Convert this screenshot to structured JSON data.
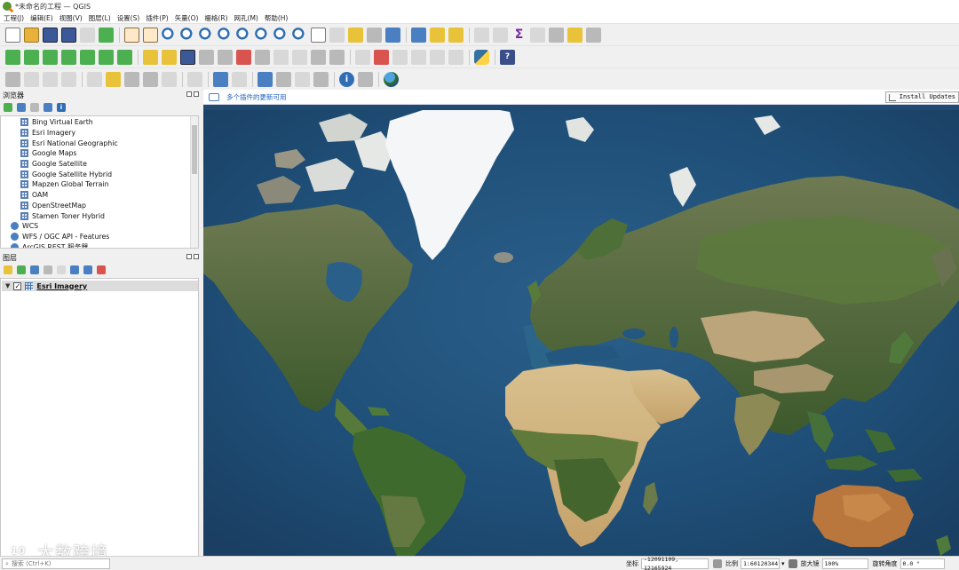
{
  "window": {
    "title": "*未命名的工程 — QGIS"
  },
  "menu": [
    "工程(J)",
    "编辑(E)",
    "视图(V)",
    "图层(L)",
    "设置(S)",
    "插件(P)",
    "矢量(O)",
    "栅格(R)",
    "网孔(M)",
    "帮助(H)"
  ],
  "toolbar": {
    "row1": [
      "new-project-icon",
      "open-project-icon",
      "save-project-icon",
      "save-as-icon",
      "print-layout-icon",
      "style-manager-icon",
      "sep",
      "pan-icon",
      "pan-to-selection-icon",
      "zoom-in-icon",
      "zoom-out-icon",
      "zoom-full-icon",
      "zoom-selection-icon",
      "zoom-layer-icon",
      "zoom-native-icon",
      "zoom-last-icon",
      "zoom-next-icon",
      "new-bookmark-icon",
      "show-bookmarks-icon",
      "map-tips-icon",
      "temporal-icon",
      "refresh-icon",
      "sep",
      "identify-icon",
      "select-icon",
      "deselect-icon",
      "sep",
      "field-calculator-icon",
      "attribute-table-icon",
      "statistics-icon",
      "layout-icon",
      "measure-icon",
      "annotation-icon",
      "settings-icon"
    ],
    "row2": [
      "data-source-icon",
      "add-vector-icon",
      "add-raster-icon",
      "add-mesh-icon",
      "add-text-icon",
      "add-virtual-icon",
      "add-wms-icon",
      "sep",
      "edit-pencil-icon",
      "toggle-edit-icon",
      "save-edits-icon",
      "digitize-icon",
      "node-tool-icon",
      "delete-icon",
      "cut-icon",
      "copy-icon",
      "paste-icon",
      "undo-icon",
      "redo-icon",
      "sep",
      "label-tool-icon",
      "pin-label-icon",
      "show-label-icon",
      "move-label-icon",
      "rotate-label-icon",
      "change-label-icon",
      "sep",
      "python-console-icon",
      "sep",
      "help-icon"
    ],
    "row3": [
      "digitize-shape-icon",
      "offset-curve-icon",
      "reshape-icon",
      "split-icon",
      "sep",
      "text-annotation-icon",
      "select-by-location-icon",
      "vertex-tool-icon",
      "simplify-icon",
      "rotate-icon",
      "sep",
      "table-icon",
      "sep",
      "georef-icon",
      "shape-icon",
      "sep",
      "identify2-icon",
      "dock-icon",
      "shape2-icon",
      "snap-icon",
      "sep",
      "info-icon",
      "measure2-icon",
      "sep",
      "globe-icon"
    ]
  },
  "browser": {
    "title": "浏览器",
    "items": [
      {
        "label": "Bing Virtual Earth",
        "type": "tile"
      },
      {
        "label": "Esri Imagery",
        "type": "tile"
      },
      {
        "label": "Esri National Geographic",
        "type": "tile"
      },
      {
        "label": "Google Maps",
        "type": "tile"
      },
      {
        "label": "Google Satellite",
        "type": "tile"
      },
      {
        "label": "Google Satellite Hybrid",
        "type": "tile"
      },
      {
        "label": "Mapzen Global Terrain",
        "type": "tile"
      },
      {
        "label": "OAM",
        "type": "tile"
      },
      {
        "label": "OpenStreetMap",
        "type": "tile"
      },
      {
        "label": "Stamen Toner Hybrid",
        "type": "tile"
      },
      {
        "label": "WCS",
        "type": "service"
      },
      {
        "label": "WFS / OGC API - Features",
        "type": "service"
      },
      {
        "label": "ArcGIS REST 服务器",
        "type": "service"
      }
    ]
  },
  "layers": {
    "title": "图层",
    "items": [
      {
        "name": "Esri Imagery",
        "checked": true,
        "expanded": true
      }
    ]
  },
  "message_bar": {
    "text": "多个插件的更新可用",
    "button": "Install Updates"
  },
  "map": {
    "layer": "Esri Imagery",
    "ocean_color": "#1f4f75"
  },
  "watermark": {
    "text": "大数跨境"
  },
  "status": {
    "search_placeholder": "搜索 (Ctrl+K)",
    "coordinate_label": "坐标",
    "coordinate": "-12091109, 12165924",
    "scale_label": "比例",
    "scale": "1:60120344",
    "magnifier_label": "放大镜",
    "magnifier": "100%",
    "rotation_label": "旋转角度",
    "rotation": "0.0 °"
  },
  "colors": {
    "accent": "#1f5fbf",
    "qgis_green": "#589632",
    "qgis_orange": "#ee7913"
  }
}
